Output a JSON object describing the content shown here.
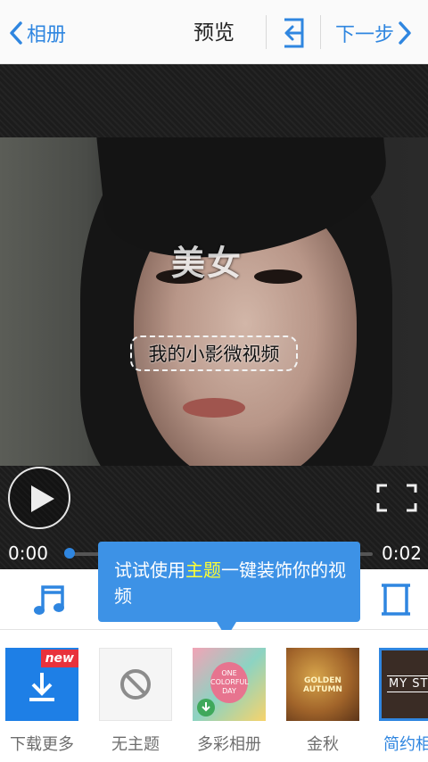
{
  "topbar": {
    "back_label": "相册",
    "title": "预览",
    "next_label": "下一步"
  },
  "video": {
    "watermark": "美女",
    "caption": "我的小影微视频"
  },
  "player": {
    "current_time": "0:00",
    "duration": "0:02",
    "progress": 0.0
  },
  "tooltip": {
    "before": "试试使用",
    "highlight": "主题",
    "after": "一键装饰你的视频"
  },
  "themes": [
    {
      "label": "下载更多",
      "badge": "new"
    },
    {
      "label": "无主题"
    },
    {
      "label": "多彩相册",
      "thumb_text": "ONE COLORFUL DAY"
    },
    {
      "label": "金秋",
      "thumb_text": "GOLDEN AUTUMN"
    },
    {
      "label": "简约相册",
      "thumb_text": "MY STO"
    }
  ],
  "colors": {
    "accent": "#2f86e0",
    "tooltip_bg": "#3d92e6",
    "highlight": "#ffff33",
    "badge": "#e8323c"
  }
}
